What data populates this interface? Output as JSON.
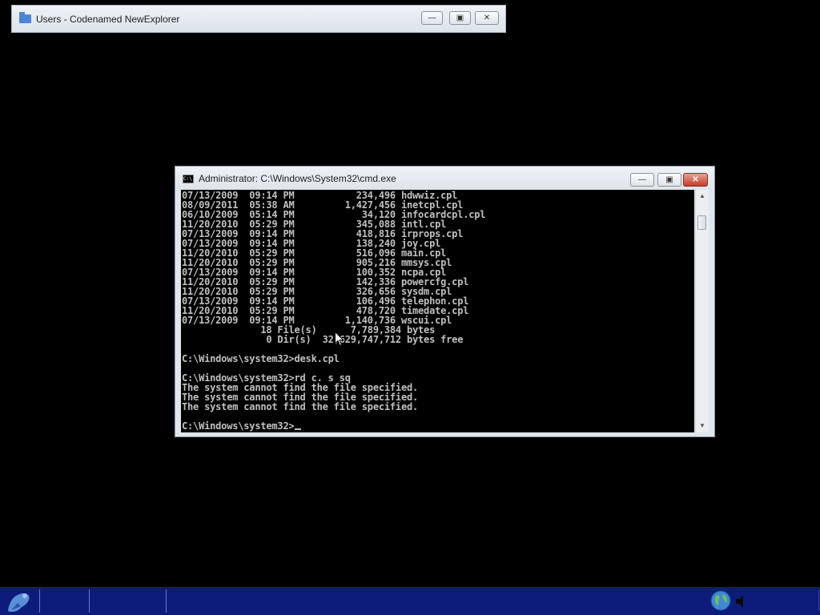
{
  "explorer_window": {
    "title": "Users - Codenamed NewExplorer",
    "icon": "folder-icon"
  },
  "cmd_window": {
    "title": "Administrator: C:\\Windows\\System32\\cmd.exe",
    "icon": "console-icon",
    "console_lines": [
      "07/13/2009  09:14 PM           234,496 hdwwiz.cpl",
      "08/09/2011  05:38 AM         1,427,456 inetcpl.cpl",
      "06/10/2009  05:14 PM            34,120 infocardcpl.cpl",
      "11/20/2010  05:29 PM           345,088 intl.cpl",
      "07/13/2009  09:14 PM           418,816 irprops.cpl",
      "07/13/2009  09:14 PM           138,240 joy.cpl",
      "11/20/2010  05:29 PM           516,096 main.cpl",
      "11/20/2010  05:29 PM           905,216 mmsys.cpl",
      "07/13/2009  09:14 PM           100,352 ncpa.cpl",
      "11/20/2010  05:29 PM           142,336 powercfg.cpl",
      "11/20/2010  05:29 PM           326,656 sysdm.cpl",
      "07/13/2009  09:14 PM           106,496 telephon.cpl",
      "11/20/2010  05:29 PM           478,720 timedate.cpl",
      "07/13/2009  09:14 PM         1,140,736 wscui.cpl",
      "              18 File(s)      7,789,384 bytes",
      "               0 Dir(s)  32,629,747,712 bytes free",
      "",
      "C:\\Windows\\system32>desk.cpl",
      "",
      "C:\\Windows\\system32>rd c. s sq",
      "The system cannot find the file specified.",
      "The system cannot find the file specified.",
      "The system cannot find the file specified.",
      ""
    ],
    "prompt": "C:\\Windows\\system32>"
  },
  "window_controls": {
    "minimize": "minimize-icon",
    "maximize": "maximize-icon",
    "close": "close-icon"
  },
  "taskbar": {
    "start_icon": "start-orb-icon",
    "tray_icons": [
      "network-globe-icon",
      "speaker-icon"
    ]
  }
}
